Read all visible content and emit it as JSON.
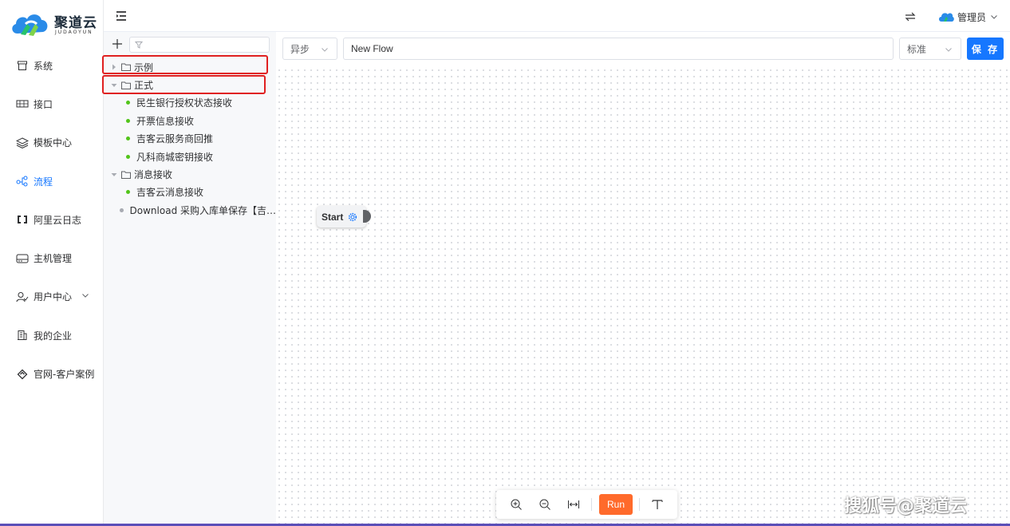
{
  "brand": {
    "name": "聚道云",
    "sub": "JUDAOYUN"
  },
  "nav": {
    "items": [
      {
        "label": "系统",
        "icon": "box-icon"
      },
      {
        "label": "接口",
        "icon": "api-icon"
      },
      {
        "label": "模板中心",
        "icon": "layers-icon"
      },
      {
        "label": "流程",
        "icon": "flow-icon",
        "active": true
      },
      {
        "label": "阿里云日志",
        "icon": "bracket-icon"
      },
      {
        "label": "主机管理",
        "icon": "server-icon"
      },
      {
        "label": "用户中心",
        "icon": "user-icon",
        "has_submenu": true
      },
      {
        "label": "我的企业",
        "icon": "building-icon"
      },
      {
        "label": "官网-客户案例",
        "icon": "diamond-icon"
      }
    ]
  },
  "header": {
    "user": "管理员"
  },
  "tree": {
    "filter_placeholder": "",
    "nodes": [
      {
        "label": "示例",
        "type": "folder",
        "expanded": false,
        "depth": 0
      },
      {
        "label": "正式",
        "type": "folder",
        "expanded": true,
        "depth": 0
      },
      {
        "label": "民生银行授权状态接收",
        "type": "flow",
        "depth": 1
      },
      {
        "label": "开票信息接收",
        "type": "flow",
        "depth": 1
      },
      {
        "label": "吉客云服务商回推",
        "type": "flow",
        "depth": 1
      },
      {
        "label": "凡科商城密钥接收",
        "type": "flow",
        "depth": 1
      },
      {
        "label": "消息接收",
        "type": "folder",
        "expanded": true,
        "depth": 0
      },
      {
        "label": "吉客云消息接收",
        "type": "flow",
        "depth": 1
      },
      {
        "label": "Download 采购入库单保存【吉…",
        "type": "flow-grey",
        "depth": 0
      }
    ]
  },
  "editor": {
    "mode": "异步",
    "flow_name": "New Flow",
    "level": "标准",
    "save_label": "保 存",
    "start_node": "Start",
    "run_label": "Run"
  },
  "colors": {
    "accent": "#1677ff",
    "run": "#ff6a2b",
    "highlight": "#e02020",
    "active_dot": "#52c41a"
  },
  "watermark": "搜狐号@聚道云"
}
